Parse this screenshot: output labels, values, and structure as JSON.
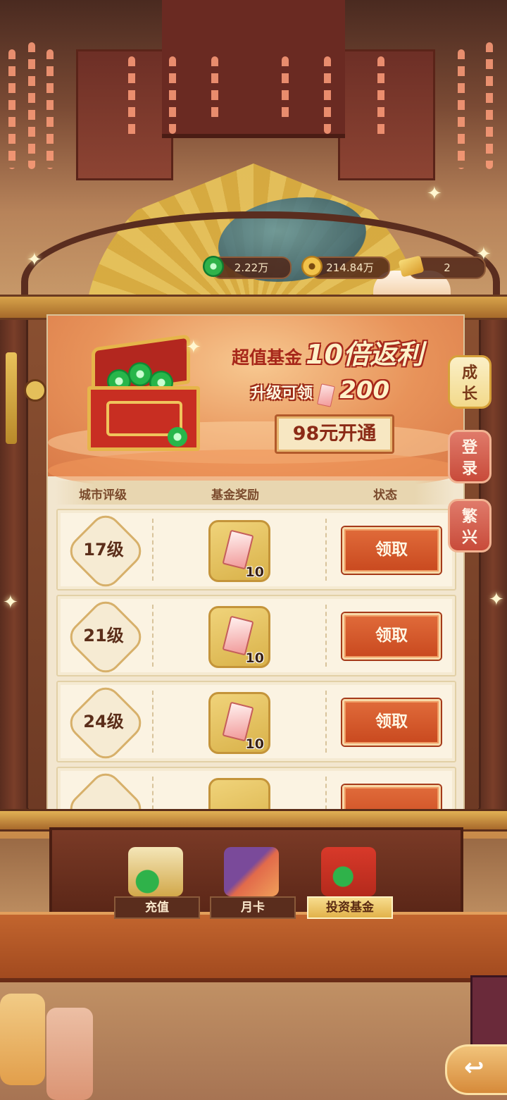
{
  "resources": [
    {
      "name": "jade",
      "value": "2.22万",
      "icon": "jade-coin-icon",
      "color": "#2fb24a"
    },
    {
      "name": "copper",
      "value": "214.84万",
      "icon": "copper-coin-icon",
      "color": "#e2a630"
    },
    {
      "name": "ticket",
      "value": "2",
      "icon": "gold-ticket-icon",
      "color": "#e8b23a"
    }
  ],
  "banner": {
    "title_prefix": "超值基金",
    "title_highlight": "10倍返利",
    "sub_prefix": "升级可领",
    "sub_amount": "200",
    "buy_button": "98元开通"
  },
  "table": {
    "headers": [
      "城市评级",
      "基金奖励",
      "状态"
    ],
    "rows": [
      {
        "level": "17级",
        "reward": "10",
        "action": "领取"
      },
      {
        "level": "21级",
        "reward": "10",
        "action": "领取"
      },
      {
        "level": "24级",
        "reward": "10",
        "action": "领取"
      }
    ]
  },
  "side_tabs": [
    "成长",
    "登录",
    "繁兴"
  ],
  "bottom_nav": [
    "充值",
    "月卡",
    "投资基金"
  ],
  "colors": {
    "claim_button": "#d9582a",
    "panel_bg": "#f2e6cf",
    "accent_gold": "#e2b24a"
  }
}
